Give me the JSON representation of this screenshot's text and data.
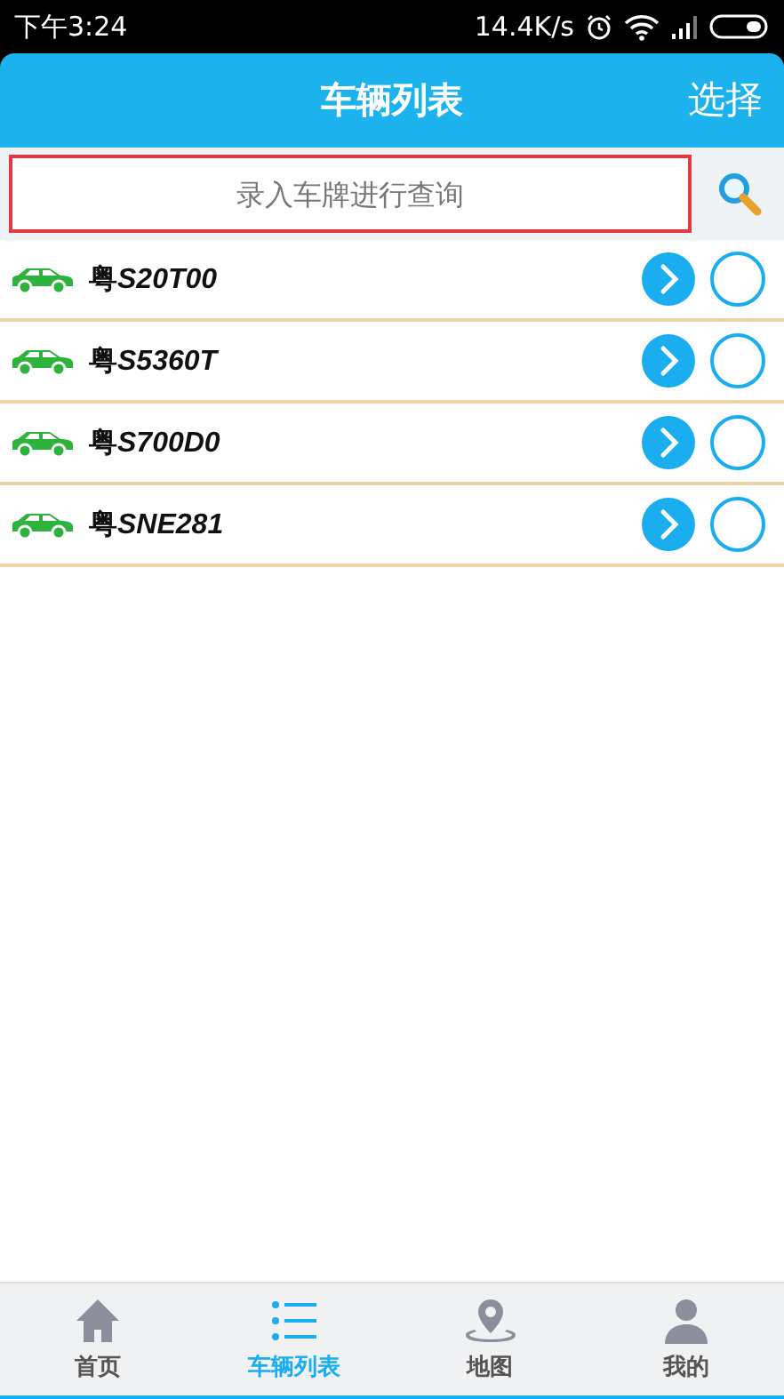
{
  "status_bar": {
    "time": "下午3:24",
    "speed": "14.4K/s"
  },
  "header": {
    "title": "车辆列表",
    "action": "选择"
  },
  "search": {
    "placeholder": "录入车牌进行查询"
  },
  "vehicles": [
    {
      "plate_prefix": "粤",
      "plate": "S20T00",
      "checked": false
    },
    {
      "plate_prefix": "粤",
      "plate": "S5360T",
      "checked": false
    },
    {
      "plate_prefix": "粤",
      "plate": "S700D0",
      "checked": false
    },
    {
      "plate_prefix": "粤",
      "plate": "SNE281",
      "checked": false
    }
  ],
  "tabs": [
    {
      "kind": "home",
      "label": "首页",
      "selected": false
    },
    {
      "kind": "list",
      "label": "车辆列表",
      "selected": true
    },
    {
      "kind": "map",
      "label": "地图",
      "selected": false
    },
    {
      "kind": "user",
      "label": "我的",
      "selected": false
    }
  ]
}
